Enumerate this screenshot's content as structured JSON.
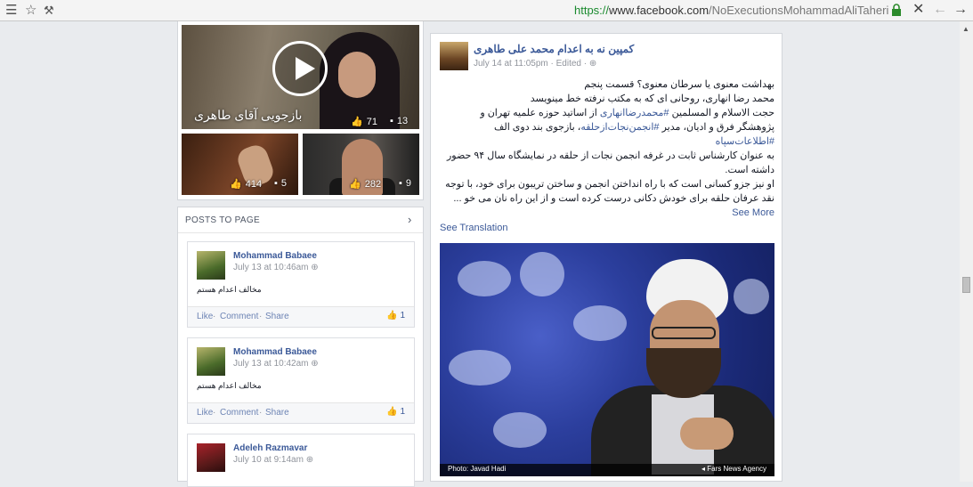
{
  "browser": {
    "url_scheme": "https://",
    "url_domain": "www.facebook.com",
    "url_path": "/NoExecutionsMohammadAliTaheri"
  },
  "videos": {
    "main": {
      "caption": "بازجویی آقای طاهری",
      "likes": "71",
      "comments": "13"
    },
    "small1": {
      "likes": "414",
      "comments": "5"
    },
    "small2": {
      "likes": "282",
      "comments": "9"
    }
  },
  "posts_to_page": {
    "heading": "POSTS TO PAGE",
    "posts": [
      {
        "name": "Mohammad Babaee",
        "date": "July 13 at 10:46am",
        "text": "مخالف اعدام هستم",
        "like": "Like",
        "comment": "Comment",
        "share": "Share",
        "likes": "1"
      },
      {
        "name": "Mohammad Babaee",
        "date": "July 13 at 10:42am",
        "text": "مخالف اعدام هستم",
        "like": "Like",
        "comment": "Comment",
        "share": "Share",
        "likes": "1"
      },
      {
        "name": "Adeleh Razmavar",
        "date": "July 10 at 9:14am"
      }
    ]
  },
  "main_post": {
    "page_name": "کمپین نه به اعدام محمد علی طاهری",
    "meta": "July 14 at 11:05pm · Edited ·",
    "line1": "بهداشت معنوی یا سرطان معنوی؟ قسمت پنجم",
    "line2": "محمد رضا انهاری، روحانی ای که به مکتب نرفته خط مینویسد",
    "line3a": "حجت الاسلام و المسلمین ",
    "hash1": "#محمدرضاانهاری",
    "line3b": " از اساتید حوزه علمیه تهران و",
    "line4a": "پژوهشگر فرق و ادیان، مدیر ",
    "hash2": "#انجمن‌نجات‌ازحلقه",
    "line4b": "، بازجوی بند دوی الف",
    "hash3": "#اطلاعات‌سپاه",
    "line6": "به عنوان کارشناس ثابت در غرفه انجمن نجات از حلقه در نمایشگاه سال ۹۴ حضور داشته است.",
    "line7": "او نیز جزو کسانی است که با راه انداختن انجمن و ساختن تریبون برای خود، با توجه نقد عرفان حلقه برای خودش دکانی درست کرده است و از این راه نان می خو ...",
    "see_more": "See More",
    "see_translation": "See Translation",
    "photo_credit": "Photo: Javad Hadi",
    "photo_agency": "Fars News Agency"
  }
}
